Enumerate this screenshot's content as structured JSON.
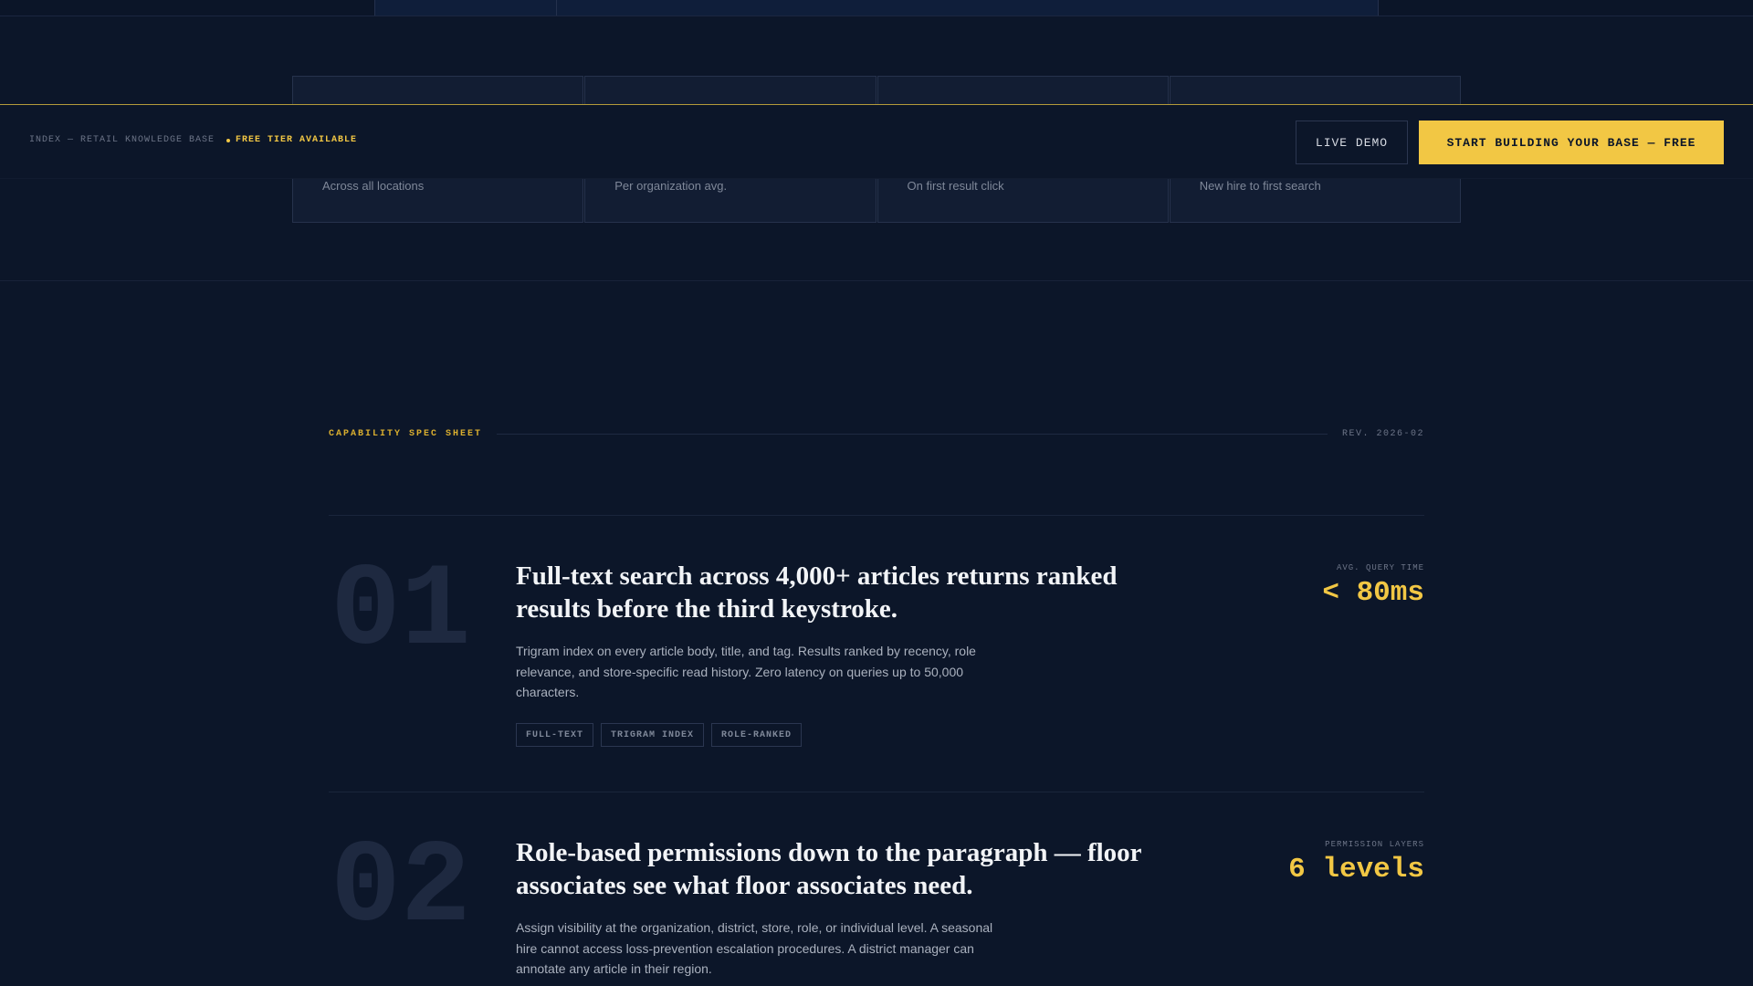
{
  "stats": {
    "items": [
      {
        "sub": "Across all locations"
      },
      {
        "sub": "Per organization avg."
      },
      {
        "sub": "On first result click"
      },
      {
        "sub": "New hire to first search"
      }
    ]
  },
  "sticky": {
    "crumb": "INDEX — RETAIL KNOWLEDGE BASE",
    "free_tier": "FREE TIER AVAILABLE",
    "demo_label": "LIVE DEMO",
    "start_label": "START BUILDING YOUR BASE — FREE",
    "accent_color": "#f2c744"
  },
  "spec": {
    "label": "CAPABILITY SPEC SHEET",
    "rev": "REV. 2026-02",
    "features": [
      {
        "num": "01",
        "title": "Full-text search across 4,000+ articles returns ranked results before the third keystroke.",
        "desc": "Trigram index on every article body, title, and tag. Results ranked by recency, role relevance, and store-specific read history. Zero latency on queries up to 50,000 characters.",
        "tags": [
          "FULL-TEXT",
          "TRIGRAM INDEX",
          "ROLE-RANKED"
        ],
        "metric_label": "AVG. QUERY TIME",
        "metric_value": "< 80ms"
      },
      {
        "num": "02",
        "title": "Role-based permissions down to the paragraph — floor associates see what floor associates need.",
        "desc": "Assign visibility at the organization, district, store, role, or individual level. A seasonal hire cannot access loss-prevention escalation procedures. A district manager can annotate any article in their region.",
        "tags": [],
        "metric_label": "PERMISSION LAYERS",
        "metric_value": "6 levels"
      }
    ]
  }
}
